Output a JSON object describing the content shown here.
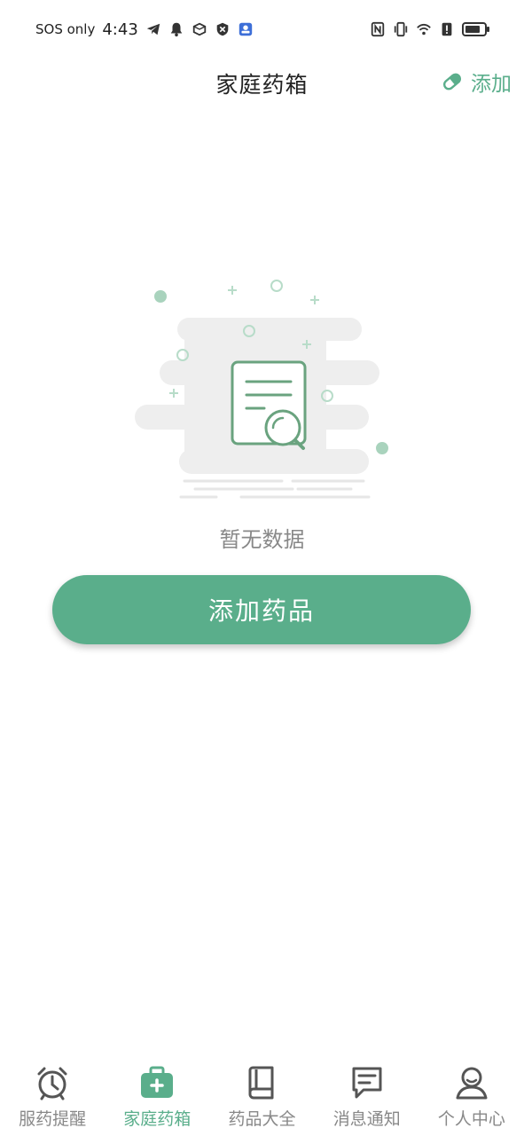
{
  "status_bar": {
    "carrier": "SOS only",
    "time": "4:43"
  },
  "header": {
    "title": "家庭药箱",
    "add_label": "添加"
  },
  "empty_state": {
    "message": "暂无数据",
    "button_label": "添加药品"
  },
  "tabs": [
    {
      "label": "服药提醒",
      "icon": "alarm-clock-icon",
      "active": false
    },
    {
      "label": "家庭药箱",
      "icon": "medicine-box-icon",
      "active": true
    },
    {
      "label": "药品大全",
      "icon": "book-icon",
      "active": false
    },
    {
      "label": "消息通知",
      "icon": "message-icon",
      "active": false
    },
    {
      "label": "个人中心",
      "icon": "user-icon",
      "active": false
    }
  ],
  "colors": {
    "accent": "#5aae8b",
    "text_muted": "#888888",
    "title": "#222222"
  }
}
